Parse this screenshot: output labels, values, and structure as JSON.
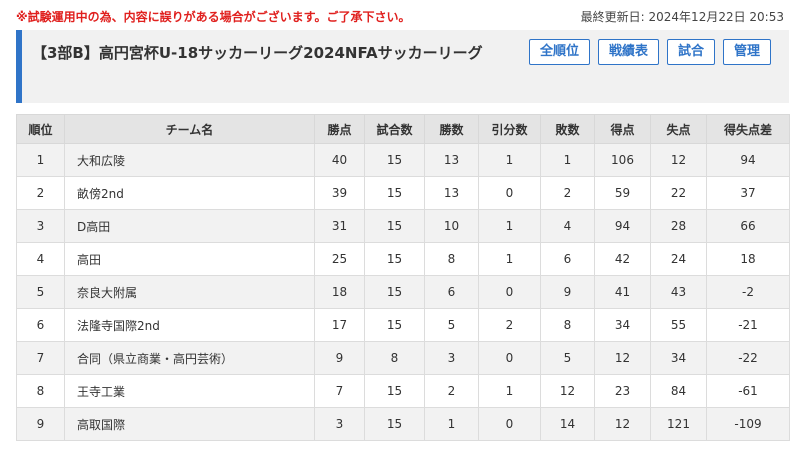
{
  "notice": "※試験運用中の為、内容に誤りがある場合がございます。ご了承下さい。",
  "last_updated": "最終更新日: 2024年12月22日 20:53",
  "league": {
    "title": "【3部B】高円宮杯U-18サッカーリーグ2024NFAサッカーリーグ"
  },
  "nav": {
    "all_rank": "全順位",
    "record": "戦績表",
    "match": "試合",
    "admin": "管理"
  },
  "table": {
    "headers": [
      "順位",
      "チーム名",
      "勝点",
      "試合数",
      "勝数",
      "引分数",
      "敗数",
      "得点",
      "失点",
      "得失点差"
    ],
    "rows": [
      [
        "1",
        "大和広陵",
        "40",
        "15",
        "13",
        "1",
        "1",
        "106",
        "12",
        "94"
      ],
      [
        "2",
        "畝傍2nd",
        "39",
        "15",
        "13",
        "0",
        "2",
        "59",
        "22",
        "37"
      ],
      [
        "3",
        "D高田",
        "31",
        "15",
        "10",
        "1",
        "4",
        "94",
        "28",
        "66"
      ],
      [
        "4",
        "高田",
        "25",
        "15",
        "8",
        "1",
        "6",
        "42",
        "24",
        "18"
      ],
      [
        "5",
        "奈良大附属",
        "18",
        "15",
        "6",
        "0",
        "9",
        "41",
        "43",
        "-2"
      ],
      [
        "6",
        "法隆寺国際2nd",
        "17",
        "15",
        "5",
        "2",
        "8",
        "34",
        "55",
        "-21"
      ],
      [
        "7",
        "合同（県立商業・高円芸術）",
        "9",
        "8",
        "3",
        "0",
        "5",
        "12",
        "34",
        "-22"
      ],
      [
        "8",
        "王寺工業",
        "7",
        "15",
        "2",
        "1",
        "12",
        "23",
        "84",
        "-61"
      ],
      [
        "9",
        "高取国際",
        "3",
        "15",
        "1",
        "0",
        "14",
        "12",
        "121",
        "-109"
      ]
    ]
  },
  "colors": {
    "accent": "#2f74c8",
    "notice": "#e0201e"
  }
}
